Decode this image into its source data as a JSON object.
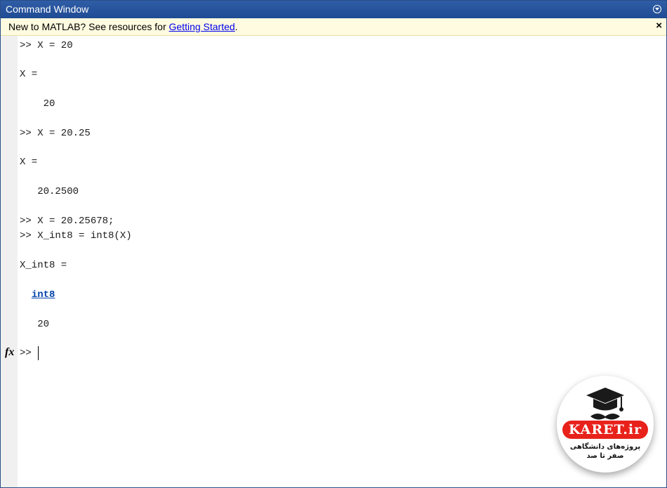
{
  "window": {
    "title": "Command Window"
  },
  "banner": {
    "prefix": "New to MATLAB? See resources for ",
    "link_text": "Getting Started",
    "suffix": ".",
    "close_label": "×"
  },
  "console": {
    "lines": [
      ">> X = 20",
      "X =",
      "    20",
      ">> X = 20.25",
      "X =",
      "   20.2500",
      ">> X = 20.25678;",
      ">> X_int8 = int8(X)",
      "X_int8 =",
      "  int8",
      "   20"
    ],
    "prompt": ">> ",
    "fx_label": "fx"
  },
  "watermark": {
    "brand": "KARET.ir",
    "tagline_1": "پروژه‌های دانشگاهی",
    "tagline_2": "صفر تا صد"
  },
  "colors": {
    "title_bar": "#2f5da6",
    "banner_bg": "#fffbe0",
    "link": "#0645ad",
    "brand_red": "#e8211b"
  }
}
